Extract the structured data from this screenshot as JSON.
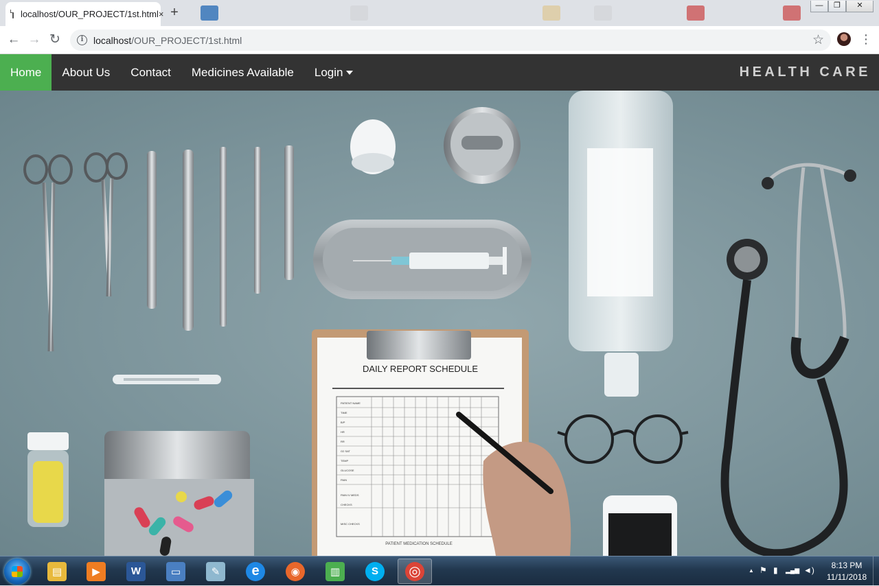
{
  "browser": {
    "tab": {
      "title": "localhost/OUR_PROJECT/1st.html",
      "close_glyph": "×"
    },
    "new_tab_glyph": "+",
    "window_controls": {
      "minimize": "—",
      "restore": "❐",
      "close": "✕"
    },
    "nav": {
      "back_glyph": "←",
      "forward_glyph": "→",
      "reload_glyph": "↻"
    },
    "address": {
      "host": "localhost",
      "path": "/OUR_PROJECT/1st.html",
      "info_glyph": "i"
    },
    "bookmark_glyph": "☆",
    "menu_glyph": "⋮"
  },
  "site": {
    "nav": {
      "home": "Home",
      "about": "About Us",
      "contact": "Contact",
      "medicines": "Medicines Available",
      "login": "Login"
    },
    "brand": "HEALTH CARE",
    "colors": {
      "navbar_bg": "#333333",
      "active_bg": "#4caf50"
    },
    "hero": {
      "clipboard_title": "DAILY REPORT SCHEDULE",
      "footer_label": "PATIENT MEDICATION SCHEDULE",
      "row_labels": [
        "PATIENT NAME",
        "TIME",
        "B/P",
        "HR",
        "RR",
        "O2 SAT",
        "TEMP",
        "GLUCOSE",
        "PAIN",
        "PAIN IV MEDS CHECKS",
        "MISC CHECKS"
      ]
    }
  },
  "taskbar": {
    "apps": [
      {
        "name": "file-explorer",
        "glyph": "▤",
        "color": "#e8b93c"
      },
      {
        "name": "media-player",
        "glyph": "▶",
        "color": "#ef7d22"
      },
      {
        "name": "word",
        "glyph": "W",
        "color": "#2b5797"
      },
      {
        "name": "remote-desktop",
        "glyph": "▭",
        "color": "#4a7fc1"
      },
      {
        "name": "notes",
        "glyph": "✎",
        "color": "#8fb8cf"
      },
      {
        "name": "internet-explorer",
        "glyph": "e",
        "color": "#1e88e5"
      },
      {
        "name": "firefox",
        "glyph": "◉",
        "color": "#e8672b"
      },
      {
        "name": "project",
        "glyph": "▥",
        "color": "#4caf50"
      },
      {
        "name": "skype",
        "glyph": "S",
        "color": "#00aff0"
      },
      {
        "name": "chrome",
        "glyph": "◎",
        "color": "#db4437"
      }
    ],
    "clock": {
      "time": "8:13 PM",
      "date": "11/11/2018"
    },
    "tray_glyphs": {
      "expand": "▲",
      "flag": "⚑",
      "power": "▮",
      "signal": "▂▄▆",
      "volume": "◄)"
    }
  }
}
